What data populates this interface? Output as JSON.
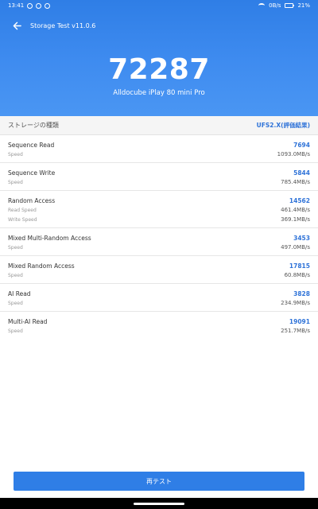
{
  "status_bar": {
    "time": "13:41",
    "net_speed": "0B/s",
    "battery": "21%"
  },
  "app_bar": {
    "title": "Storage Test v11.0.6"
  },
  "result": {
    "score": "72287",
    "device": "Alldocube iPlay 80 mini Pro"
  },
  "storage_type": {
    "label": "ストレージの種類",
    "value": "UFS2.X(評価結果)"
  },
  "tests": [
    {
      "name": "Sequence Read",
      "score": "7694",
      "rows": [
        {
          "label": "Speed",
          "value": "1093.0MB/s"
        }
      ]
    },
    {
      "name": "Sequence Write",
      "score": "5844",
      "rows": [
        {
          "label": "Speed",
          "value": "785.4MB/s"
        }
      ]
    },
    {
      "name": "Random Access",
      "score": "14562",
      "rows": [
        {
          "label": "Read Speed",
          "value": "461.4MB/s"
        },
        {
          "label": "Write Speed",
          "value": "369.1MB/s"
        }
      ]
    },
    {
      "name": "Mixed Multi-Random Access",
      "score": "3453",
      "rows": [
        {
          "label": "Speed",
          "value": "497.0MB/s"
        }
      ]
    },
    {
      "name": "Mixed Random Access",
      "score": "17815",
      "rows": [
        {
          "label": "Speed",
          "value": "60.8MB/s"
        }
      ]
    },
    {
      "name": "AI Read",
      "score": "3828",
      "rows": [
        {
          "label": "Speed",
          "value": "234.9MB/s"
        }
      ]
    },
    {
      "name": "Multi-AI Read",
      "score": "19091",
      "rows": [
        {
          "label": "Speed",
          "value": "251.7MB/s"
        }
      ]
    }
  ],
  "retest_button": {
    "label": "再テスト"
  },
  "colors": {
    "accent": "#2f7ee6",
    "score_text": "#2f73d8"
  }
}
